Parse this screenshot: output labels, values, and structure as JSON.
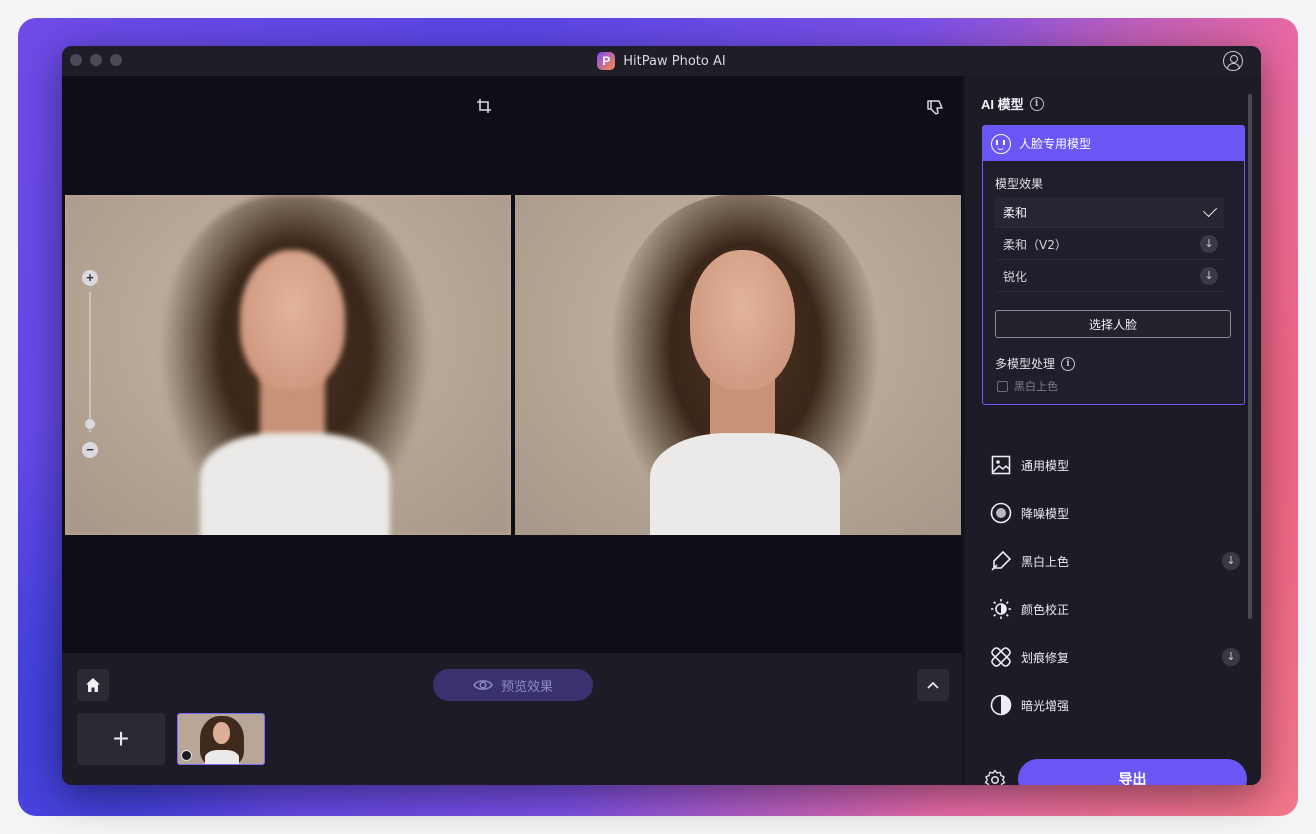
{
  "window": {
    "app_title": "HitPaw Photo AI"
  },
  "icons": {
    "logo": "hitpaw-logo",
    "account": "account-icon",
    "crop": "crop-icon",
    "dislike": "thumbs-down-icon",
    "home": "home-icon",
    "eye": "eye-icon",
    "chevron_up": "chevron-up-icon",
    "settings": "gear-icon"
  },
  "logo_text": "P",
  "canvas": {
    "zoom_in": "+",
    "zoom_out": "−",
    "zoom_level": 0.1
  },
  "bottom": {
    "preview_label": "预览效果",
    "add_label": "+"
  },
  "panel": {
    "title": "AI 模型",
    "face_model": {
      "label": "人脸专用模型",
      "effect_label": "模型效果",
      "options": [
        {
          "label": "柔和",
          "selected": true
        },
        {
          "label": "柔和（V2）",
          "download": true
        },
        {
          "label": "锐化",
          "download": true
        }
      ],
      "select_face_button": "选择人脸",
      "multi_model_label": "多模型处理",
      "bw_colorize_label": "黑白上色"
    },
    "models": [
      {
        "label": "通用模型",
        "icon": "image-icon",
        "download": false
      },
      {
        "label": "降噪模型",
        "icon": "denoise-icon",
        "download": false
      },
      {
        "label": "黑白上色",
        "icon": "colorize-icon",
        "download": true
      },
      {
        "label": "颜色校正",
        "icon": "brightness-icon",
        "download": false
      },
      {
        "label": "划痕修复",
        "icon": "bandage-icon",
        "download": true
      },
      {
        "label": "暗光增强",
        "icon": "contrast-icon",
        "download": false
      }
    ],
    "export_label": "导出"
  },
  "colors": {
    "accent": "#6a55f5",
    "panel_bg": "#1c1b26",
    "canvas_bg": "#0f0e17"
  }
}
